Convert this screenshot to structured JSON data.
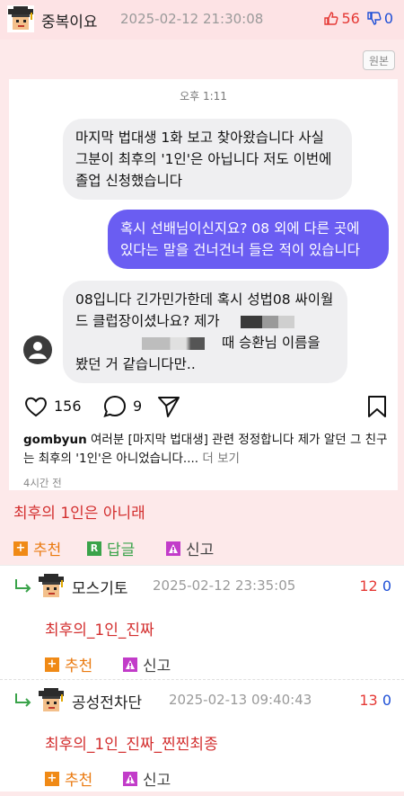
{
  "post": {
    "author": "중복이요",
    "datetime": "2025-02-12 21:30:08",
    "upvotes": "56",
    "downvotes": "0",
    "original_label": "원본",
    "text": "최후의 1인은 아니래",
    "recommend_label": "추천",
    "reply_label": "답글",
    "report_label": "신고"
  },
  "screenshot": {
    "time": "오후 1:11",
    "msg1": "마지막 법대생 1화 보고 찾아왔습니다 사실 그분이 최후의 '1인'은 아닙니다 저도 이번에 졸업 신청했습니다",
    "msg2": "혹시 선배님이신지요? 08 외에 다른 곳에 있다는 말을 건너건너 들은 적이 있습니다",
    "msg3_a": "08입니다 긴가민가한데 혹시 성법08 싸이월드 클럽장이셨나요? 제가",
    "msg3_b": "때 승환님 이름을 봤던 거 같습니다만..",
    "likes": "156",
    "comments": "9",
    "caption_user": "gombyun",
    "caption_text": "여러분 [마지막 법대생] 관련 정정합니다 제가 알던 그 친구는 최후의 '1인'은 아니었습니다....",
    "caption_more": "더 보기",
    "ago": "4시간 전"
  },
  "replies": [
    {
      "author": "모스기토",
      "datetime": "2025-02-12 23:35:05",
      "upvotes": "12",
      "downvotes": "0",
      "text": "최후의_1인_진짜",
      "recommend_label": "추천",
      "report_label": "신고"
    },
    {
      "author": "공성전차단",
      "datetime": "2025-02-13 09:40:43",
      "upvotes": "13",
      "downvotes": "0",
      "text": "최후의_1인_진짜_찐찐최종",
      "recommend_label": "추천",
      "report_label": "신고"
    }
  ],
  "colors": {
    "post_bg": "#fde9ea",
    "header_bg": "#fde3e5",
    "up": "#e53935",
    "down": "#1e4fd6",
    "comment_text": "#d32f2f",
    "out_bubble": "#6a5df2",
    "recommend": "#ea7a10",
    "reply_green": "#3aa34a"
  },
  "icons": [
    "graduation-cap-avatar-icon",
    "thumbs-up-icon",
    "thumbs-down-icon",
    "heart-icon",
    "comment-bubble-icon",
    "send-icon",
    "bookmark-icon",
    "plus-icon",
    "reply-r-icon",
    "report-icon",
    "reply-arrow-icon"
  ]
}
